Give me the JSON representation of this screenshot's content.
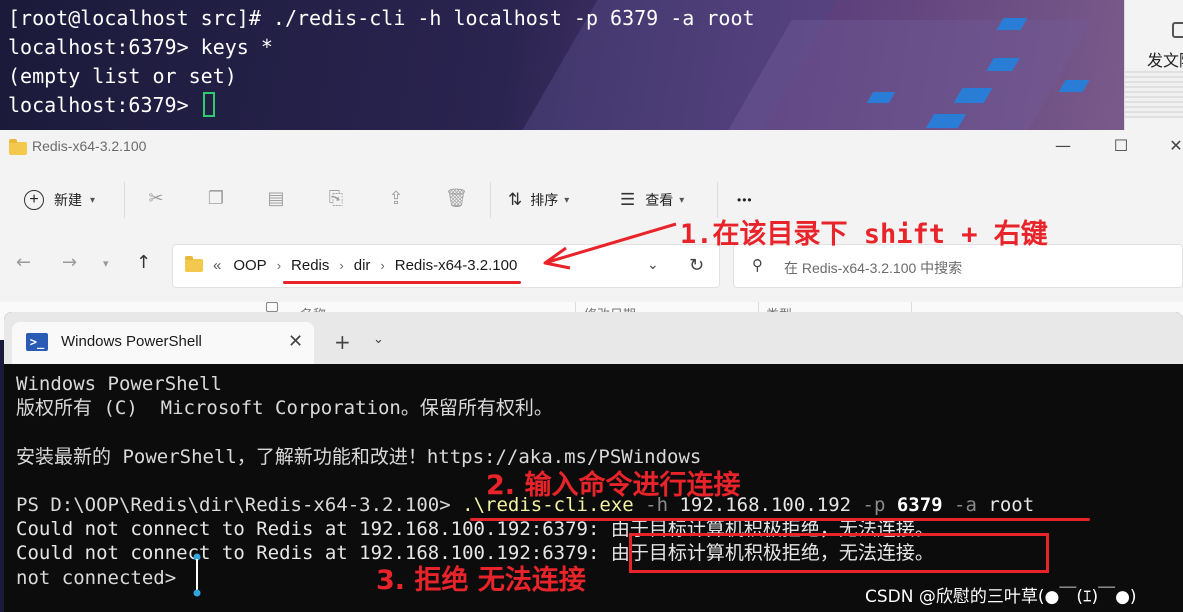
{
  "top_terminal": {
    "lines": [
      "[root@localhost src]# ./redis-cli -h localhost -p 6379 -a root",
      "localhost:6379> keys *",
      "(empty list or set)",
      "localhost:6379> "
    ]
  },
  "right_window": {
    "text": "发文随"
  },
  "explorer": {
    "title": "Redis-x64-3.2.100",
    "toolbar": {
      "new_label": "新建",
      "sort_label": "排序",
      "view_label": "查看",
      "more_label": "•••"
    },
    "breadcrumb": {
      "overflow": "«",
      "items": [
        "OOP",
        "Redis",
        "dir",
        "Redis-x64-3.2.100"
      ]
    },
    "search_placeholder": "在 Redis-x64-3.2.100 中搜索",
    "columns": [
      "名称",
      "修改日期",
      "类型"
    ]
  },
  "powershell": {
    "tab_label": "Windows PowerShell",
    "banner_line1": "Windows PowerShell",
    "banner_line2": "版权所有 (C)  Microsoft Corporation。保留所有权利。",
    "banner_line3": "安装最新的 PowerShell，了解新功能和改进！https://aka.ms/PSWindows",
    "prompt": "PS D:\\OOP\\Redis\\dir\\Redis-x64-3.2.100> ",
    "cmd_exe": ".\\redis-cli.exe",
    "cmd_flag_h": " -h",
    "cmd_host": " 192.168.100.192",
    "cmd_flag_p": " -p",
    "cmd_port": " 6379",
    "cmd_flag_a": " -a",
    "cmd_pass": " root",
    "error_prefix": "Could not connect to Redis at 192.168.100.192:6379: ",
    "error_msg": "由于目标计算机积极拒绝，无法连接。",
    "not_connected": "not connected> "
  },
  "annotations": {
    "step1": "1.在该目录下 shift + 右键",
    "step2": "2. 输入命令进行连接",
    "step3": "3. 拒绝 无法连接"
  },
  "watermark": "CSDN @欣慰的三叶草(●￣(ｴ)￣●)",
  "colors": {
    "annotation_red": "#e8242a",
    "terminal_bg": "#0c0c0c",
    "cursor_green": "#2ecc71"
  }
}
